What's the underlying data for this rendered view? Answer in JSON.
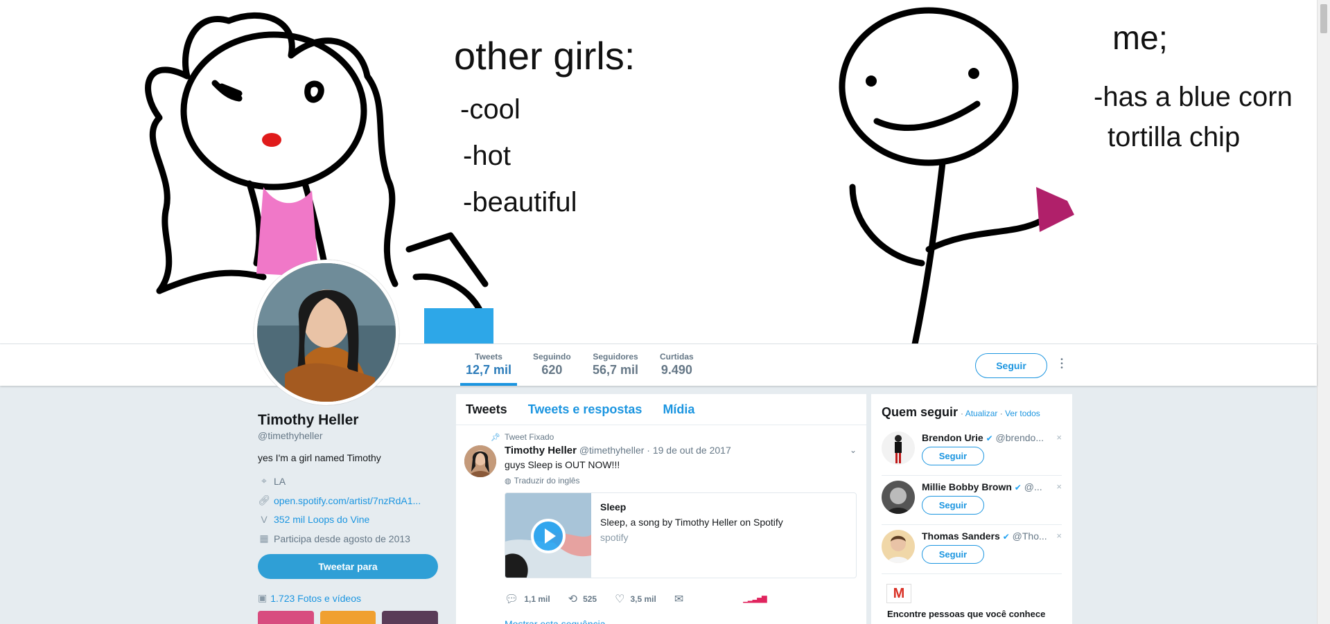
{
  "banner": {
    "lines": {
      "other_girls": "other girls:",
      "cool": "-cool",
      "hot": "-hot",
      "beautiful": "-beautiful",
      "me": "me;",
      "has_blue_corn": "-has a blue corn",
      "tortilla_chip": "tortilla chip"
    }
  },
  "nav": {
    "stats": [
      {
        "label": "Tweets",
        "value": "12,7 mil"
      },
      {
        "label": "Seguindo",
        "value": "620"
      },
      {
        "label": "Seguidores",
        "value": "56,7 mil"
      },
      {
        "label": "Curtidas",
        "value": "9.490"
      }
    ],
    "follow_label": "Seguir",
    "more_icon": "more-vertical-icon"
  },
  "profile": {
    "name": "Timothy Heller",
    "handle": "@timethyheller",
    "bio": "yes I'm a girl named Timothy",
    "location": "LA",
    "website": "open.spotify.com/artist/7nzRdA1...",
    "vine": "352 mil Loops do Vine",
    "joined": "Participa desde agosto de 2013",
    "tweet_to_label": "Tweetar para",
    "media_label": "1.723 Fotos e vídeos"
  },
  "timeline": {
    "tabs": [
      "Tweets",
      "Tweets e respostas",
      "Mídia"
    ],
    "tweet": {
      "pinned_label": "Tweet Fixado",
      "name": "Timothy Heller",
      "handle": "@timethyheller",
      "separator": "·",
      "date": "19 de out de 2017",
      "text": "guys Sleep is OUT NOW!!!",
      "translate": "Traduzir do inglês",
      "card": {
        "title": "Sleep",
        "description": "Sleep, a song by Timothy Heller on Spotify",
        "domain": "spotify"
      },
      "replies": "1,1 mil",
      "retweets": "525",
      "likes": "3,5 mil",
      "show_thread": "Mostrar esta sequência"
    }
  },
  "who_to_follow": {
    "title": "Quem seguir",
    "refresh": "Atualizar",
    "dot": "·",
    "view_all": "Ver todos",
    "follow_label": "Seguir",
    "close_glyph": "×",
    "users": [
      {
        "name": "Brendon Urie",
        "handle": "@brendo..."
      },
      {
        "name": "Millie Bobby Brown",
        "handle": "@..."
      },
      {
        "name": "Thomas Sanders",
        "handle": "@Tho..."
      }
    ],
    "gmail_text": "Encontre pessoas que você conhece"
  },
  "colors": {
    "accent": "#1b95e0",
    "background": "#e6ecf0"
  }
}
